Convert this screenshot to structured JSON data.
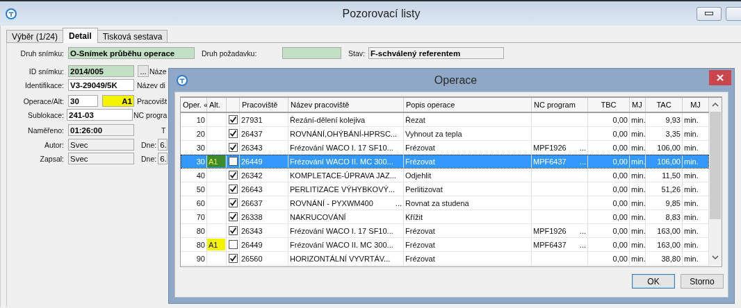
{
  "window": {
    "title": "Pozorovací listy"
  },
  "tabs": [
    {
      "label": "Výběr (1/24)",
      "selected": false
    },
    {
      "label": "Detail",
      "selected": true
    },
    {
      "label": "Tisková sestava",
      "selected": false
    }
  ],
  "form": [
    {
      "items": [
        {
          "kind": "label",
          "text": "Druh snímku:"
        },
        {
          "kind": "field",
          "color": "#c2e0c4",
          "bold": true,
          "value": "O-Snímek průběhu operace"
        },
        {
          "kind": "label",
          "text": "Druh požadavku:"
        },
        {
          "kind": "field",
          "color": "#c2e0c4"
        },
        {
          "kind": "label",
          "text": "Stav:"
        },
        {
          "kind": "field",
          "color": "#f0f0f0",
          "bold": true,
          "value": "F-schválený referentem"
        }
      ]
    },
    {
      "items": [
        {
          "kind": "label",
          "text": "ID snímku:"
        },
        {
          "kind": "field",
          "color": "#c2e0c4",
          "bold": true,
          "value": "2014/005"
        },
        {
          "kind": "button",
          "text": "..."
        },
        {
          "kind": "label",
          "text": "Náze"
        }
      ]
    },
    {
      "items": [
        {
          "kind": "label",
          "text": "Identifikace:"
        },
        {
          "kind": "field",
          "color": "#ffffff",
          "bold": true,
          "value": "V3-29049/5K"
        },
        {
          "kind": "label",
          "text": "Název di"
        }
      ]
    },
    {
      "items": [
        {
          "kind": "label",
          "text": "Operace/Alt:"
        },
        {
          "kind": "field",
          "color": "#ffffff",
          "bold": true,
          "value": "30"
        },
        {
          "kind": "field",
          "color": "#f4f400",
          "bold": true,
          "value": "A1"
        },
        {
          "kind": "label",
          "text": "Pracovišt"
        }
      ]
    },
    {
      "items": [
        {
          "kind": "label",
          "text": "Sublokace:"
        },
        {
          "kind": "field",
          "color": "#ffffff",
          "bold": true,
          "value": "241-03"
        },
        {
          "kind": "label",
          "text": "NC progra"
        }
      ]
    },
    {
      "items": [
        {
          "kind": "label",
          "text": "Naměřeno:"
        },
        {
          "kind": "field",
          "color": "#f0f0f0",
          "bold": true,
          "value": "01:26:00"
        },
        {
          "kind": "label",
          "text": "T"
        }
      ]
    },
    {
      "items": [
        {
          "kind": "label",
          "text": "Autor:"
        },
        {
          "kind": "field",
          "color": "#f0f0f0",
          "bold": false,
          "value": "Svec"
        },
        {
          "kind": "label",
          "text": "Dne:"
        },
        {
          "kind": "field",
          "color": "#f0f0f0",
          "bold": false,
          "value": "6."
        }
      ]
    },
    {
      "items": [
        {
          "kind": "label",
          "text": "Zapsal:"
        },
        {
          "kind": "field",
          "color": "#f0f0f0",
          "bold": false,
          "value": "Svec"
        },
        {
          "kind": "label",
          "text": "Dne:"
        },
        {
          "kind": "field",
          "color": "#f0f0f0",
          "bold": false,
          "value": "6."
        }
      ]
    }
  ],
  "dialog": {
    "title": "Operace",
    "columns": [
      "Oper. «",
      "Alt.",
      "",
      "Pracoviště",
      "Název pracoviště",
      "Popis operace",
      "NC program",
      "TBC",
      "MJ",
      "TAC",
      "MJ"
    ],
    "rows": [
      {
        "oper": "10",
        "checked": true,
        "selected": false,
        "workplace": "27931",
        "name": "Řezání-dělení kolejiva",
        "description": "Řezat",
        "tbc": "0,00",
        "tbc_unit": "min.",
        "tac": "9,93",
        "tac_unit": "min."
      },
      {
        "oper": "20",
        "checked": true,
        "selected": false,
        "workplace": "26437",
        "name": "ROVNÁNÍ,OHÝBÁNÍ-HPRSC...",
        "description": "Vyhnout za tepla",
        "tbc": "0,00",
        "tbc_unit": "min.",
        "tac": "3,35",
        "tac_unit": "min."
      },
      {
        "oper": "30",
        "checked": true,
        "selected": false,
        "workplace": "26343",
        "name": "Frézování WACO I. 17 SF10...",
        "description": "Frézovat",
        "nc_program": "MPF1926",
        "nc_more": "...",
        "tbc": "0,00",
        "tbc_unit": "min.",
        "tac": "106,00",
        "tac_unit": "min."
      },
      {
        "oper": "30",
        "alt": {
          "text": "A1",
          "color": "#3c8c2c"
        },
        "checked": false,
        "selected": true,
        "workplace": "26449",
        "name": "Frézování WACO II. MC 300...",
        "description": "Frézovat",
        "nc_program": "MPF6437",
        "nc_more": "...",
        "tbc": "0,00",
        "tbc_unit": "min.",
        "tac": "106,00",
        "tac_unit": "min."
      },
      {
        "oper": "40",
        "checked": true,
        "selected": false,
        "workplace": "26342",
        "name": "KOMPLETACE-ÚPRAVA JAZ...",
        "description": "Odjehlit",
        "tbc": "0,00",
        "tbc_unit": "min.",
        "tac": "11,50",
        "tac_unit": "min."
      },
      {
        "oper": "50",
        "checked": true,
        "selected": false,
        "workplace": "26643",
        "name": "PERLITIZACE VÝHYBKOVÝ...",
        "description": "Perlitizovat",
        "tbc": "0,00",
        "tbc_unit": "min.",
        "tac": "51,26",
        "tac_unit": "min."
      },
      {
        "oper": "60",
        "checked": true,
        "selected": false,
        "workplace": "26637",
        "name": "ROVNÁNÍ - PYXWM400",
        "name_more": "...",
        "description": "Rovnat za studena",
        "tbc": "0,00",
        "tbc_unit": "min.",
        "tac": "9,85",
        "tac_unit": "min."
      },
      {
        "oper": "70",
        "checked": true,
        "selected": false,
        "workplace": "26338",
        "name": "NAKRUCOVÁNÍ",
        "description": "Křížit",
        "tbc": "0,00",
        "tbc_unit": "min.",
        "tac": "8,83",
        "tac_unit": "min."
      },
      {
        "oper": "80",
        "checked": true,
        "selected": false,
        "workplace": "26343",
        "name": "Frézování WACO I. 17 SF10...",
        "description": "Frézovat",
        "nc_program": "MPF1926",
        "nc_more": "...",
        "tbc": "0,00",
        "tbc_unit": "min.",
        "tac": "163,00",
        "tac_unit": "min."
      },
      {
        "oper": "80",
        "alt": {
          "text": "A1",
          "color": "#f4f400"
        },
        "checked": false,
        "selected": false,
        "workplace": "26449",
        "name": "Frézování WACO II. MC 300...",
        "description": "Frézovat",
        "nc_program": "MPF6437",
        "nc_more": "...",
        "tbc": "0,00",
        "tbc_unit": "min.",
        "tac": "163,00",
        "tac_unit": "min."
      },
      {
        "oper": "90",
        "checked": true,
        "selected": false,
        "workplace": "26560",
        "name": "HORIZONTÁLNÍ VYVRTÁV...",
        "description": "Frézovat",
        "tbc": "0,00",
        "tbc_unit": "min.",
        "tac": "38,80",
        "tac_unit": "min."
      }
    ],
    "buttons": [
      "OK",
      "Storno"
    ]
  }
}
